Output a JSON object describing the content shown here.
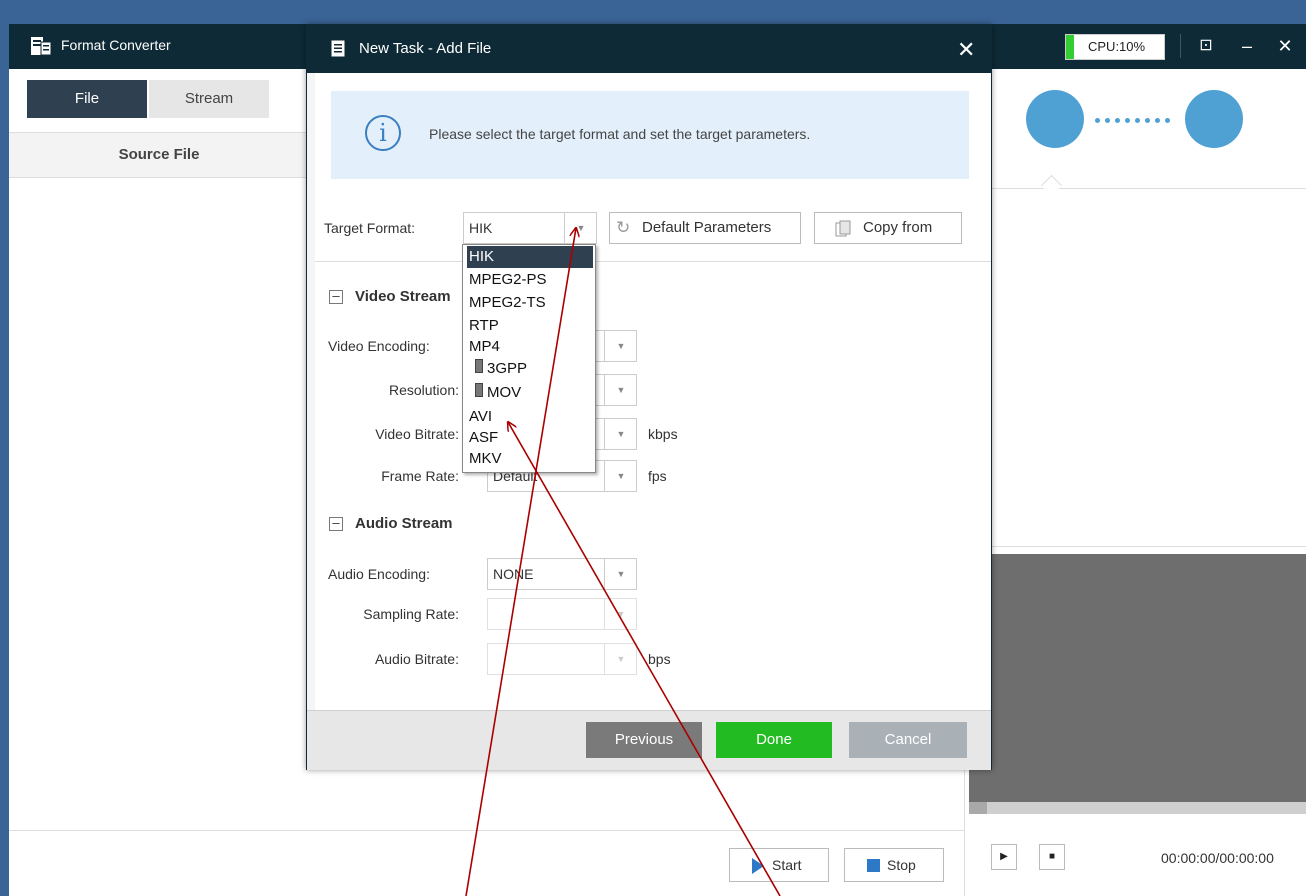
{
  "app": {
    "title": "Format Converter",
    "cpu": "CPU:10%",
    "minimize_glyph": "–",
    "close_glyph": "✕",
    "settings_glyph": "⊡"
  },
  "tabs": [
    {
      "label": "File",
      "active": true
    },
    {
      "label": "Stream",
      "active": false
    }
  ],
  "table": {
    "headers": [
      "Source File"
    ]
  },
  "bottom_buttons": {
    "start": "Start",
    "stop": "Stop"
  },
  "player": {
    "timecode": "00:00:00/00:00:00",
    "play_glyph": "▶",
    "stop_glyph": "■"
  },
  "dialog": {
    "title": "New Task - Add File",
    "close_glyph": "✕",
    "info_text": "Please select the target format and set the target parameters.",
    "info_icon": "i",
    "target_format": {
      "label": "Target Format:",
      "value": "HIK",
      "options": [
        "HIK",
        "MPEG2-PS",
        "MPEG2-TS",
        "RTP",
        "MP4",
        "3GPP",
        "MOV",
        "AVI",
        "ASF",
        "MKV"
      ],
      "selected_index": 0
    },
    "default_params_button": "Default Parameters",
    "copy_from_button": "Copy from",
    "video_section": "Video Stream",
    "video_fields": {
      "encoding_label": "Video Encoding:",
      "resolution_label": "Resolution:",
      "bitrate_label": "Video Bitrate:",
      "bitrate_unit": "kbps",
      "framerate_label": "Frame Rate:",
      "framerate_value": "Default",
      "framerate_unit": "fps"
    },
    "audio_section": "Audio Stream",
    "audio_fields": {
      "encoding_label": "Audio Encoding:",
      "encoding_value": "NONE",
      "sampling_label": "Sampling Rate:",
      "bitrate_label": "Audio Bitrate:",
      "bitrate_unit": "bps"
    },
    "footer": {
      "previous": "Previous",
      "done": "Done",
      "cancel": "Cancel"
    }
  },
  "colors": {
    "titlebar": "#0e2a36",
    "accent_blue": "#4fa0d3",
    "done_green": "#22bb22",
    "previous_gray": "#7a7a7a",
    "cancel_gray": "#a9b0b6",
    "annotation": "#aa0000"
  },
  "icons": [
    "app-icon",
    "info-icon",
    "refresh-icon",
    "copy-icon",
    "play-icon",
    "stop-icon",
    "minimize-icon",
    "close-icon",
    "device-icon",
    "chevron-down-icon"
  ]
}
